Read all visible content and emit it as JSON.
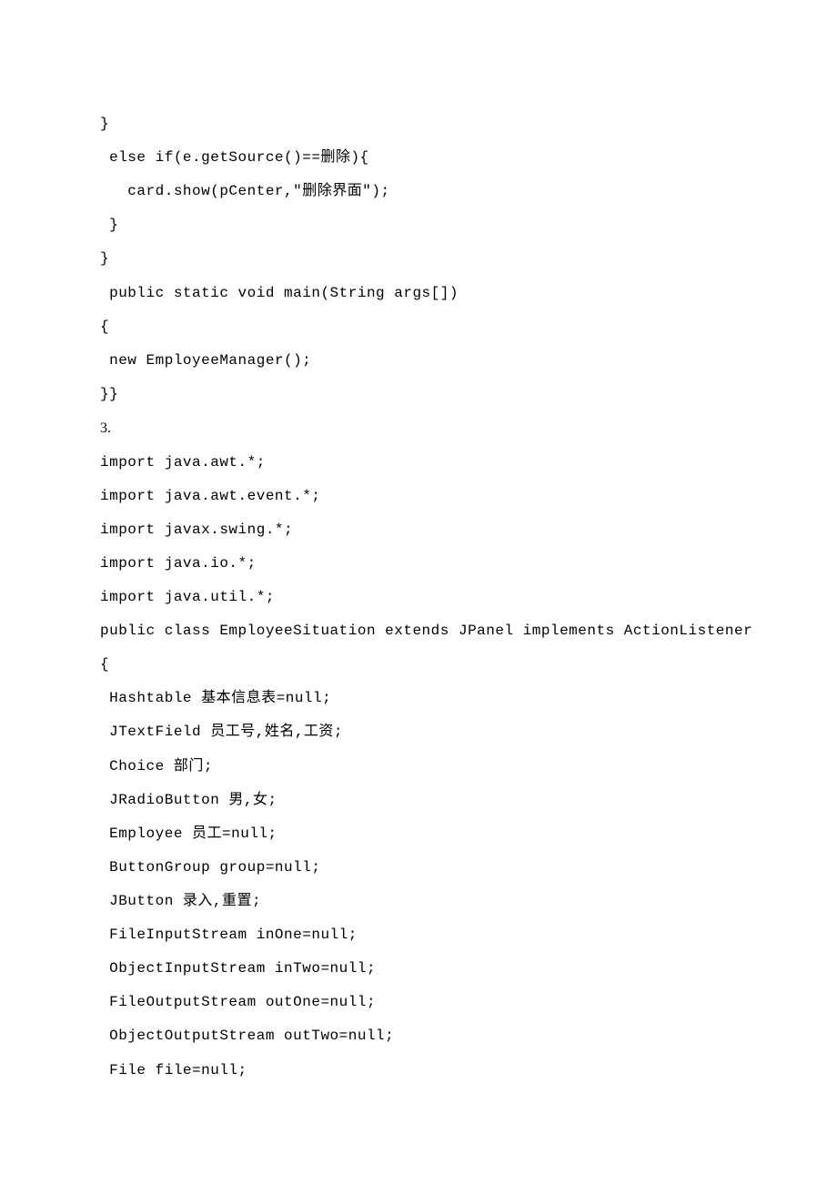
{
  "lines": [
    {
      "text": "}",
      "cls": "code-line"
    },
    {
      "text": " else if(e.getSource()==删除){",
      "cls": "code-line"
    },
    {
      "text": "   card.show(pCenter,\"删除界面\");",
      "cls": "code-line"
    },
    {
      "text": " }",
      "cls": "code-line"
    },
    {
      "text": "}",
      "cls": "code-line"
    },
    {
      "text": " public static void main(String args[])",
      "cls": "code-line"
    },
    {
      "text": "{",
      "cls": "code-line"
    },
    {
      "text": " new EmployeeManager();",
      "cls": "code-line"
    },
    {
      "text": "}}",
      "cls": "code-line"
    },
    {
      "text": "3.",
      "cls": "section-num"
    },
    {
      "text": "import java.awt.*;",
      "cls": "code-line"
    },
    {
      "text": "import java.awt.event.*;",
      "cls": "code-line"
    },
    {
      "text": "import javax.swing.*;",
      "cls": "code-line"
    },
    {
      "text": "import java.io.*;",
      "cls": "code-line"
    },
    {
      "text": "import java.util.*;",
      "cls": "code-line"
    },
    {
      "text": "public class EmployeeSituation extends JPanel implements ActionListener",
      "cls": "code-line"
    },
    {
      "text": "{",
      "cls": "code-line"
    },
    {
      "text": " Hashtable 基本信息表=null;",
      "cls": "code-line"
    },
    {
      "text": " JTextField 员工号,姓名,工资;",
      "cls": "code-line"
    },
    {
      "text": " Choice 部门;",
      "cls": "code-line"
    },
    {
      "text": " JRadioButton 男,女;",
      "cls": "code-line"
    },
    {
      "text": " Employee 员工=null;",
      "cls": "code-line"
    },
    {
      "text": " ButtonGroup group=null;",
      "cls": "code-line"
    },
    {
      "text": " JButton 录入,重置;",
      "cls": "code-line"
    },
    {
      "text": " FileInputStream inOne=null;",
      "cls": "code-line"
    },
    {
      "text": " ObjectInputStream inTwo=null;",
      "cls": "code-line"
    },
    {
      "text": " FileOutputStream outOne=null;",
      "cls": "code-line"
    },
    {
      "text": " ObjectOutputStream outTwo=null;",
      "cls": "code-line"
    },
    {
      "text": " File file=null;",
      "cls": "code-line"
    }
  ]
}
